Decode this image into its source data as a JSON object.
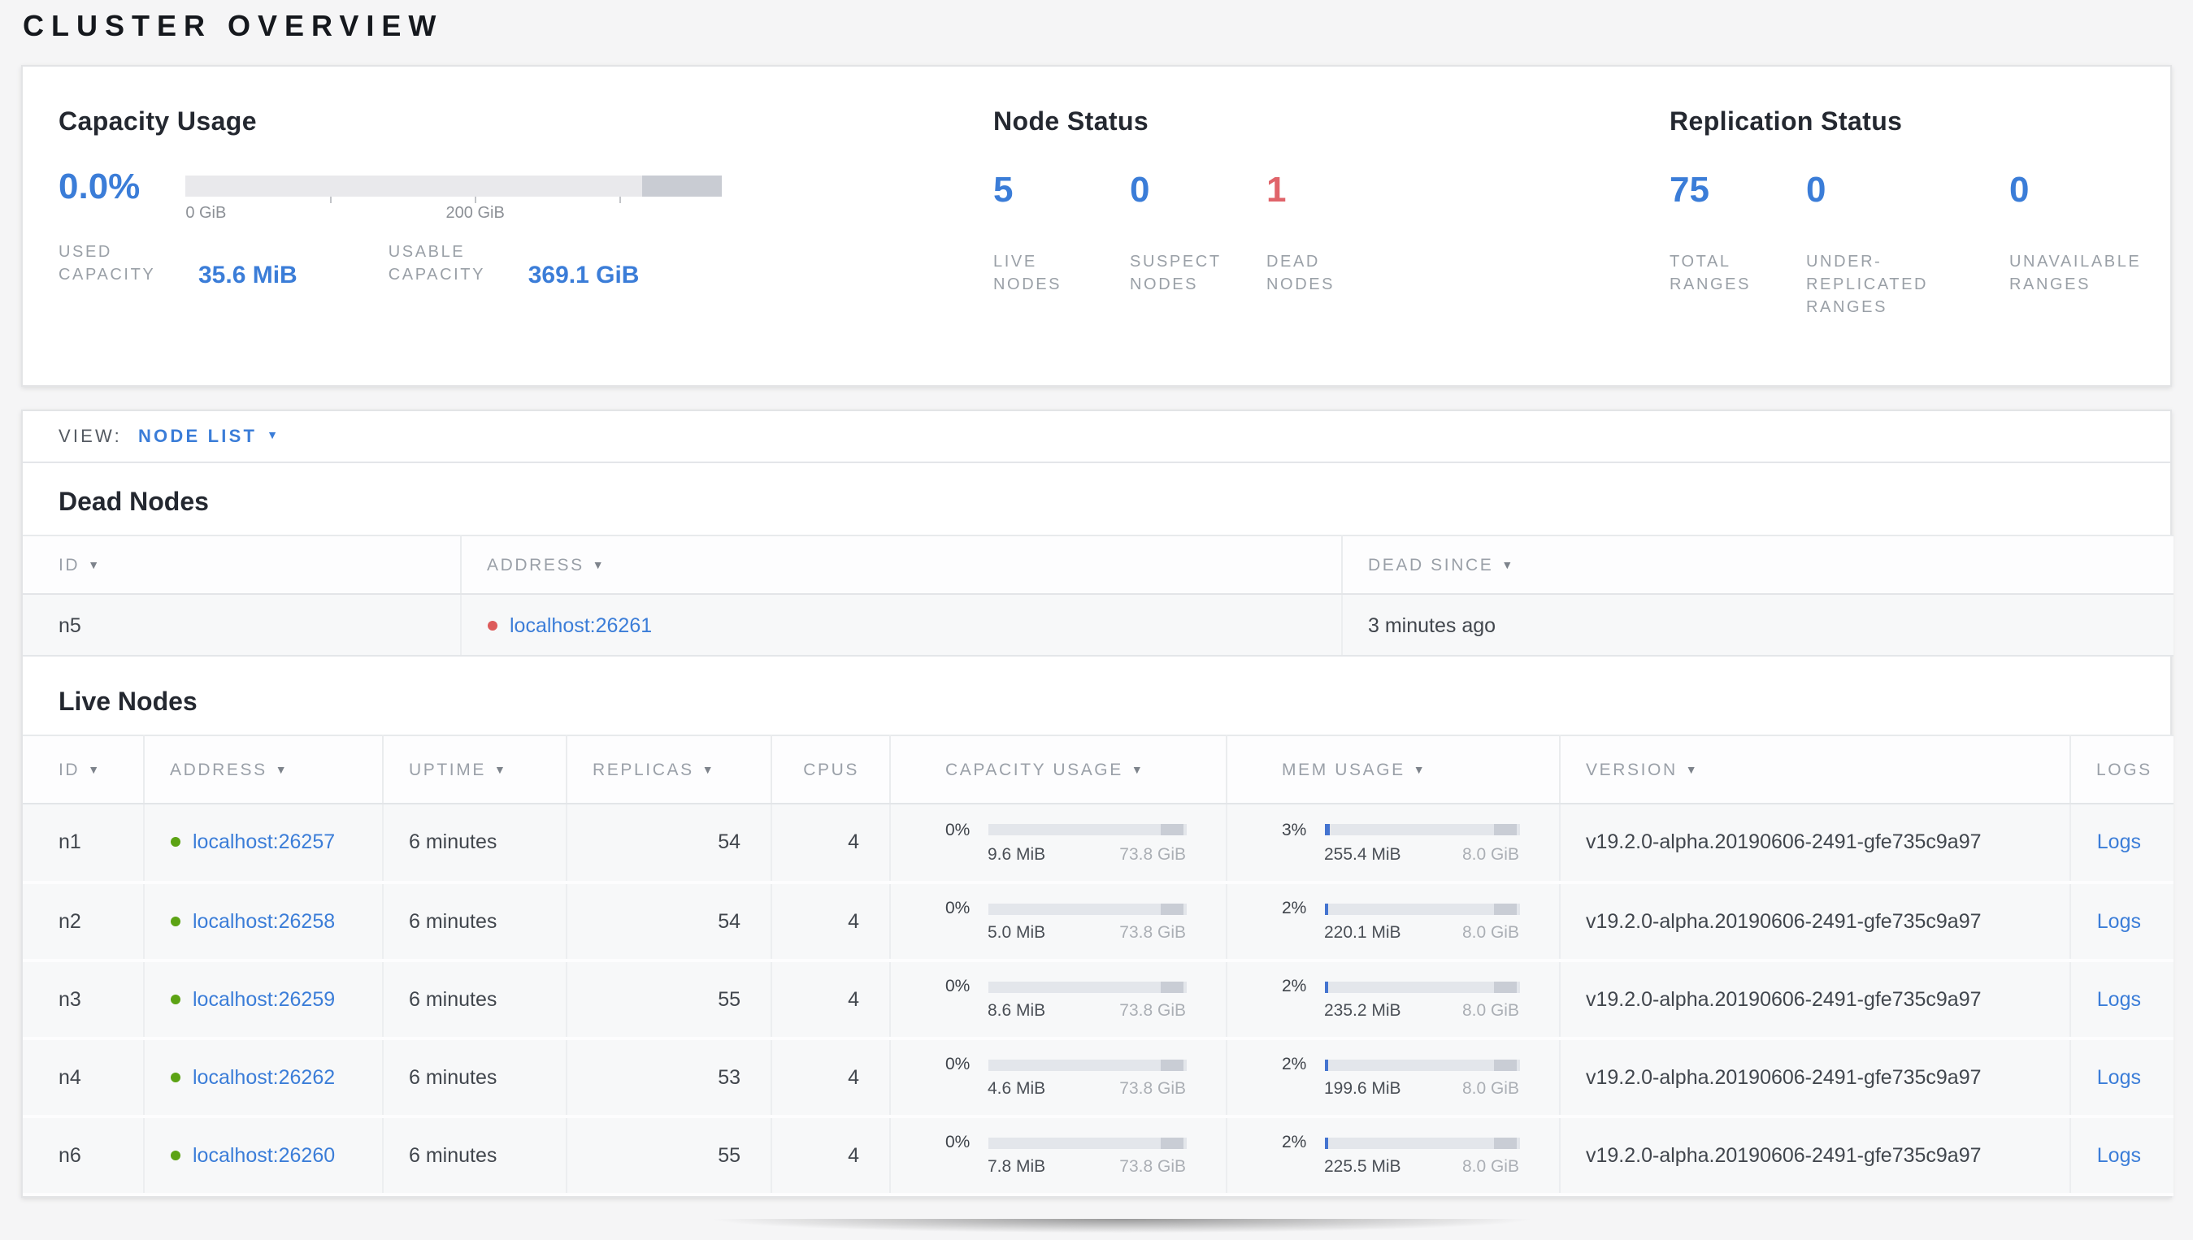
{
  "colors": {
    "accent": "#3b7dd8",
    "danger": "#e0646a",
    "live-dot": "#5ca314",
    "dead-dot": "#dd5b5b"
  },
  "icons": {
    "sort_arrow": "▼",
    "caret_down": "▼"
  },
  "page": {
    "title": "CLUSTER OVERVIEW"
  },
  "summary": {
    "capacity": {
      "title": "Capacity Usage",
      "percent": "0.0%",
      "bar": {
        "fill_pct": 0
      },
      "axis": {
        "label_start": "0 GiB",
        "label_mid": "200 GiB"
      },
      "stats": [
        {
          "label": "USED CAPACITY",
          "value": "35.6 MiB"
        },
        {
          "label": "USABLE CAPACITY",
          "value": "369.1 GiB"
        }
      ]
    },
    "node_status": {
      "title": "Node Status",
      "stats": [
        {
          "value": "5",
          "label": "LIVE NODES",
          "color": "#3b7dd8"
        },
        {
          "value": "0",
          "label": "SUSPECT NODES",
          "color": "#3b7dd8"
        },
        {
          "value": "1",
          "label": "DEAD NODES",
          "color": "#e0646a"
        }
      ]
    },
    "replication": {
      "title": "Replication Status",
      "stats": [
        {
          "value": "75",
          "label": "TOTAL RANGES",
          "color": "#3b7dd8"
        },
        {
          "value": "0",
          "label": "UNDER-REPLICATED RANGES",
          "color": "#3b7dd8"
        },
        {
          "value": "0",
          "label": "UNAVAILABLE RANGES",
          "color": "#3b7dd8"
        }
      ]
    }
  },
  "view_bar": {
    "label": "VIEW:",
    "selected": "NODE LIST"
  },
  "dead_nodes": {
    "title": "Dead Nodes",
    "columns": [
      {
        "label": "ID",
        "sortable": true
      },
      {
        "label": "ADDRESS",
        "sortable": true
      },
      {
        "label": "DEAD SINCE",
        "sortable": true
      }
    ],
    "rows": [
      {
        "id": "n5",
        "address": "localhost:26261",
        "dead_since": "3 minutes ago"
      }
    ]
  },
  "live_nodes": {
    "title": "Live Nodes",
    "logs_label": "Logs",
    "columns": [
      {
        "label": "ID",
        "sortable": true
      },
      {
        "label": "ADDRESS",
        "sortable": true
      },
      {
        "label": "UPTIME",
        "sortable": true
      },
      {
        "label": "REPLICAS",
        "sortable": true
      },
      {
        "label": "CPUS",
        "sortable": false
      },
      {
        "label": "CAPACITY USAGE",
        "sortable": true
      },
      {
        "label": "MEM USAGE",
        "sortable": true
      },
      {
        "label": "VERSION",
        "sortable": true
      },
      {
        "label": "LOGS",
        "sortable": false
      }
    ],
    "rows": [
      {
        "id": "n1",
        "address": "localhost:26257",
        "uptime": "6 minutes",
        "replicas": "54",
        "cpus": "4",
        "capacity": {
          "percent": "0%",
          "fill_pct": 0,
          "used": "9.6 MiB",
          "total": "73.8 GiB"
        },
        "mem": {
          "percent": "3%",
          "fill_pct": 3,
          "used": "255.4 MiB",
          "total": "8.0 GiB"
        },
        "version": "v19.2.0-alpha.20190606-2491-gfe735c9a97"
      },
      {
        "id": "n2",
        "address": "localhost:26258",
        "uptime": "6 minutes",
        "replicas": "54",
        "cpus": "4",
        "capacity": {
          "percent": "0%",
          "fill_pct": 0,
          "used": "5.0 MiB",
          "total": "73.8 GiB"
        },
        "mem": {
          "percent": "2%",
          "fill_pct": 2,
          "used": "220.1 MiB",
          "total": "8.0 GiB"
        },
        "version": "v19.2.0-alpha.20190606-2491-gfe735c9a97"
      },
      {
        "id": "n3",
        "address": "localhost:26259",
        "uptime": "6 minutes",
        "replicas": "55",
        "cpus": "4",
        "capacity": {
          "percent": "0%",
          "fill_pct": 0,
          "used": "8.6 MiB",
          "total": "73.8 GiB"
        },
        "mem": {
          "percent": "2%",
          "fill_pct": 2,
          "used": "235.2 MiB",
          "total": "8.0 GiB"
        },
        "version": "v19.2.0-alpha.20190606-2491-gfe735c9a97"
      },
      {
        "id": "n4",
        "address": "localhost:26262",
        "uptime": "6 minutes",
        "replicas": "53",
        "cpus": "4",
        "capacity": {
          "percent": "0%",
          "fill_pct": 0,
          "used": "4.6 MiB",
          "total": "73.8 GiB"
        },
        "mem": {
          "percent": "2%",
          "fill_pct": 2,
          "used": "199.6 MiB",
          "total": "8.0 GiB"
        },
        "version": "v19.2.0-alpha.20190606-2491-gfe735c9a97"
      },
      {
        "id": "n6",
        "address": "localhost:26260",
        "uptime": "6 minutes",
        "replicas": "55",
        "cpus": "4",
        "capacity": {
          "percent": "0%",
          "fill_pct": 0,
          "used": "7.8 MiB",
          "total": "73.8 GiB"
        },
        "mem": {
          "percent": "2%",
          "fill_pct": 2,
          "used": "225.5 MiB",
          "total": "8.0 GiB"
        },
        "version": "v19.2.0-alpha.20190606-2491-gfe735c9a97"
      }
    ]
  }
}
